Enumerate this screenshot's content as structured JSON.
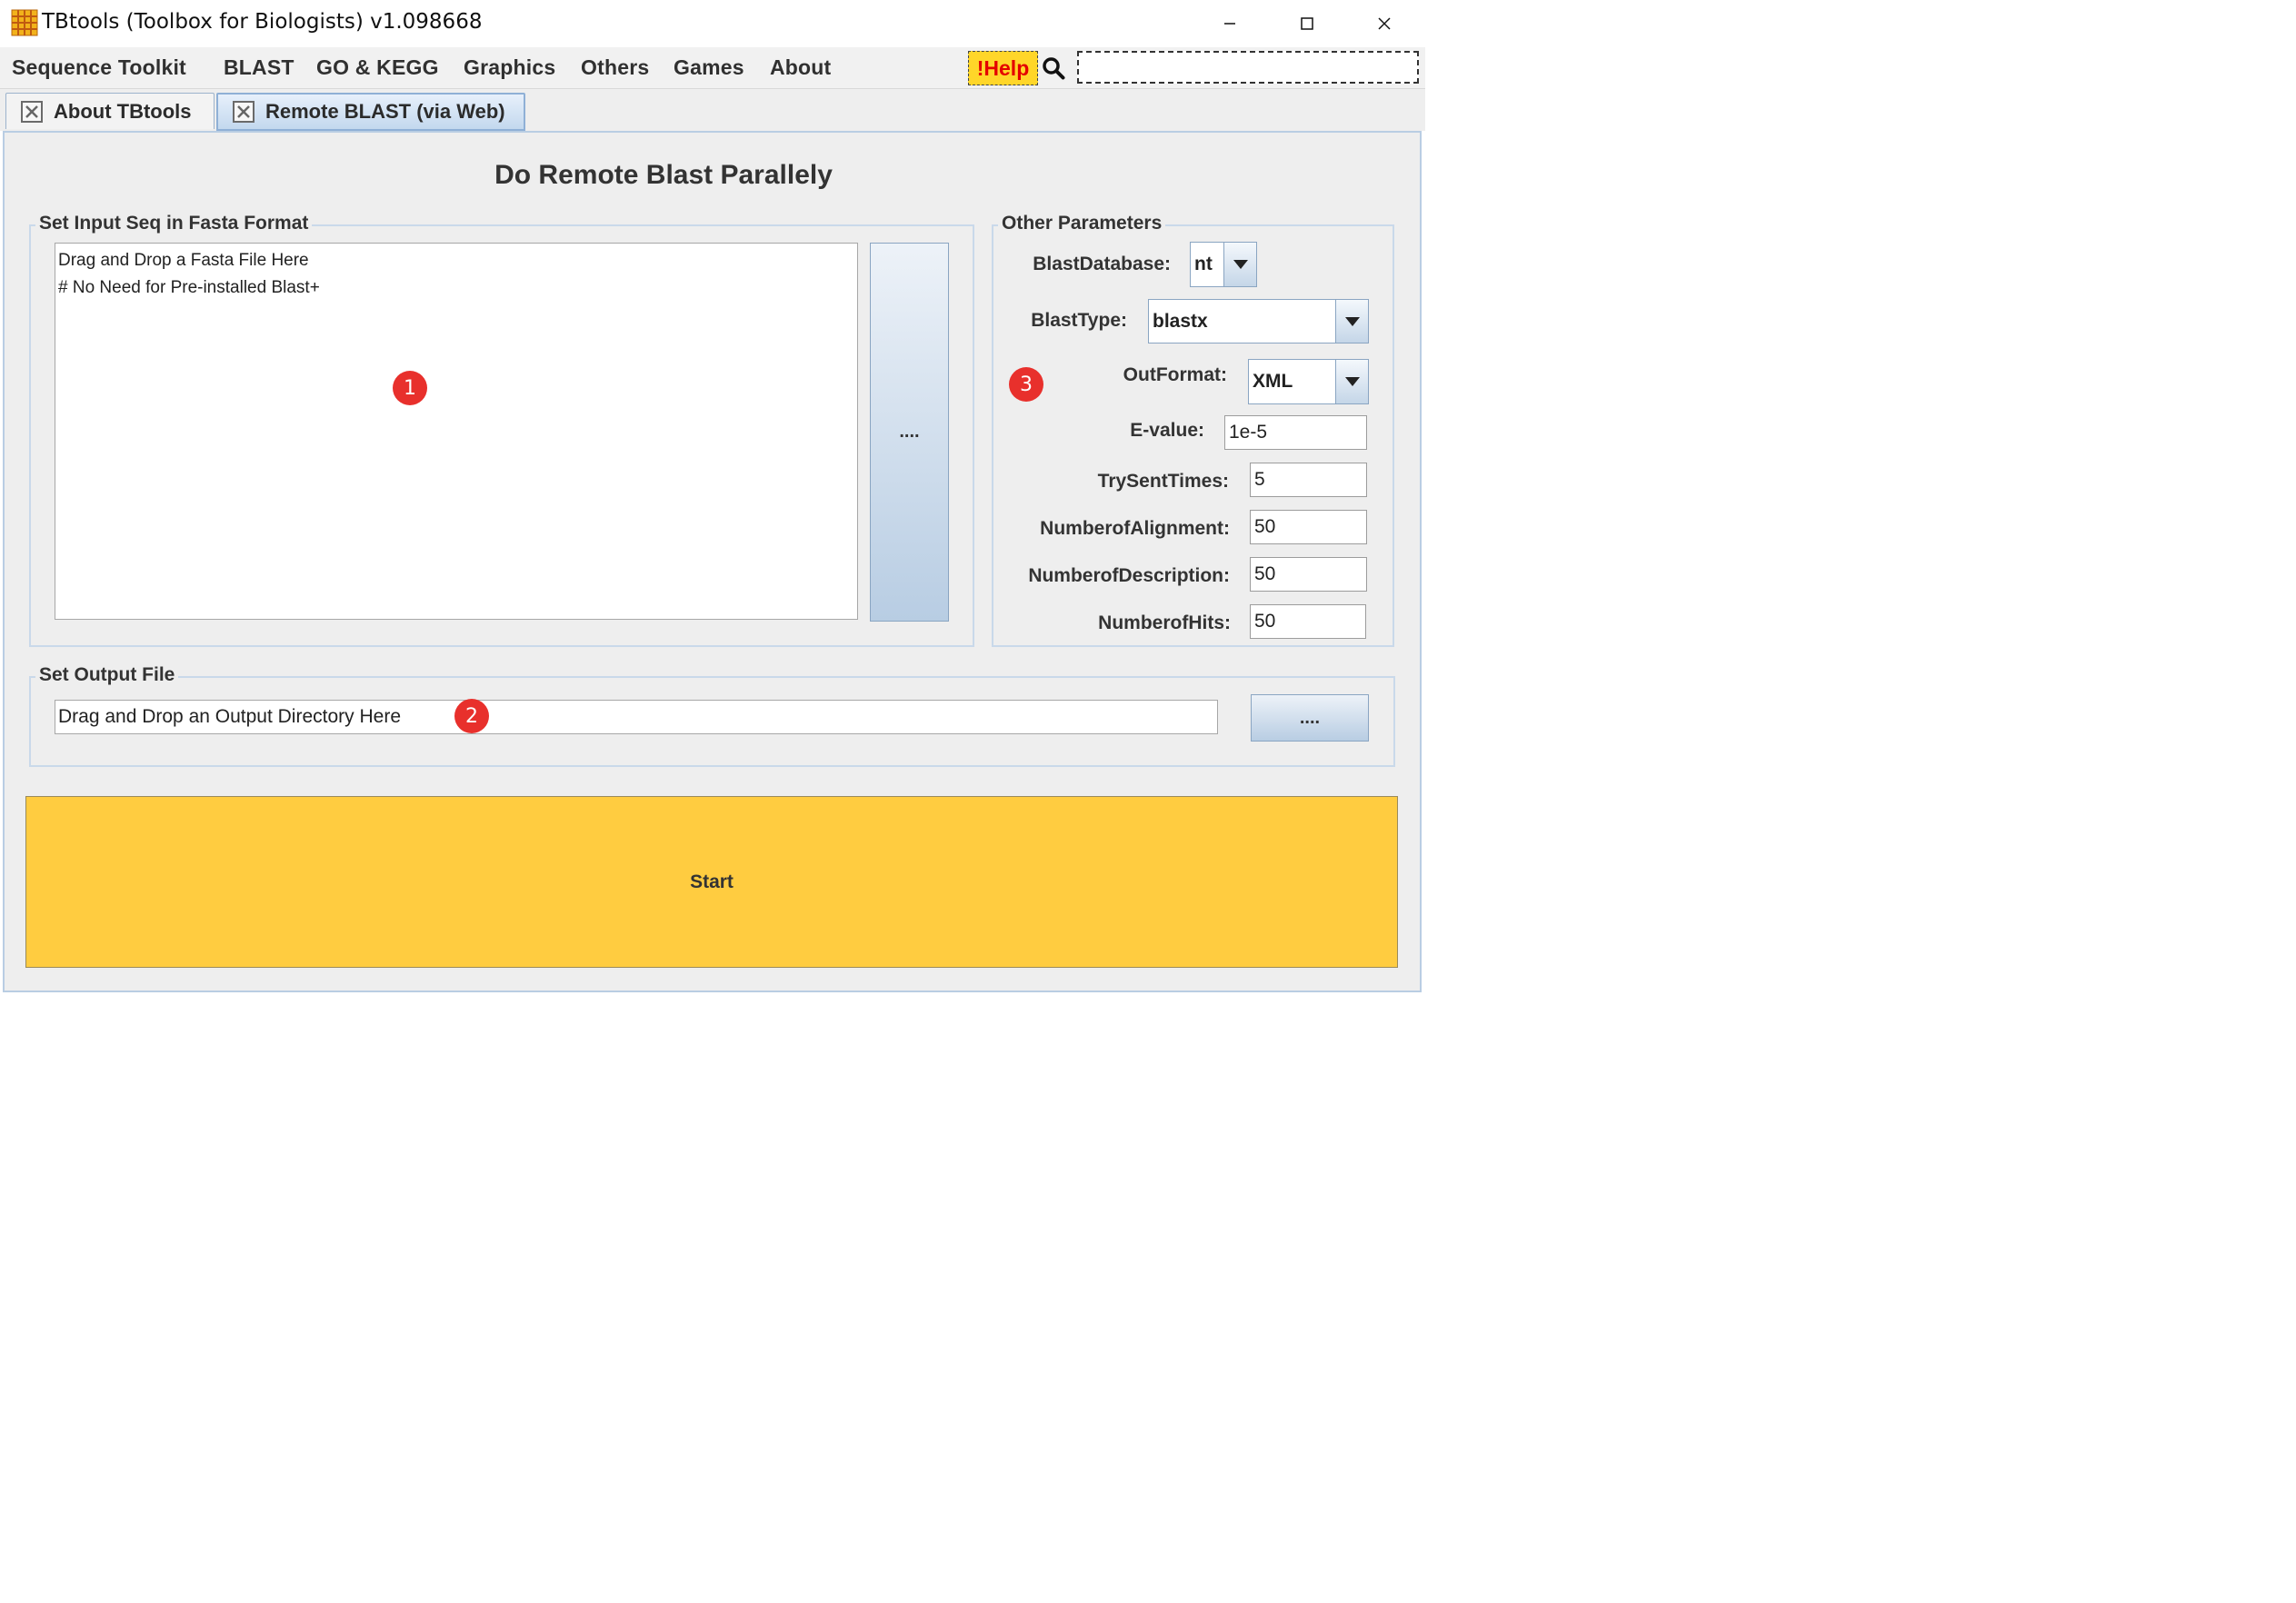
{
  "window": {
    "title": "TBtools (Toolbox for Biologists) v1.098668",
    "minimize_icon": "minimize-icon",
    "maximize_icon": "maximize-icon",
    "close_icon": "close-icon"
  },
  "menubar": {
    "items": [
      {
        "label": "Sequence Toolkit"
      },
      {
        "label": "BLAST"
      },
      {
        "label": "GO & KEGG"
      },
      {
        "label": "Graphics"
      },
      {
        "label": "Others"
      },
      {
        "label": "Games"
      },
      {
        "label": "About"
      }
    ],
    "help_label": "!Help",
    "search_icon": "search-icon",
    "search_value": ""
  },
  "tabs": [
    {
      "label": "About TBtools",
      "selected": false
    },
    {
      "label": "Remote BLAST (via Web)",
      "selected": true
    }
  ],
  "main": {
    "title": "Do Remote Blast Parallely",
    "input_group": {
      "title": "Set Input Seq in Fasta Format",
      "placeholder_lines": [
        "Drag and Drop a Fasta File Here",
        "# No Need for Pre-installed Blast+"
      ],
      "browse_label": "...."
    },
    "params_group": {
      "title": "Other Parameters",
      "blast_database": {
        "label": "BlastDatabase:",
        "value": "nt"
      },
      "blast_type": {
        "label": "BlastType:",
        "value": "blastx"
      },
      "out_format": {
        "label": "OutFormat:",
        "value": "XML"
      },
      "evalue": {
        "label": "E-value:",
        "value": "1e-5"
      },
      "try_sent_times": {
        "label": "TrySentTimes:",
        "value": "5"
      },
      "number_of_alignment": {
        "label": "NumberofAlignment:",
        "value": "50"
      },
      "number_of_description": {
        "label": "NumberofDescription:",
        "value": "50"
      },
      "number_of_hits": {
        "label": "NumberofHits:",
        "value": "50"
      }
    },
    "output_group": {
      "title": "Set Output File",
      "value": "Drag and Drop an Output Directory Here",
      "browse_label": "...."
    },
    "start_label": "Start"
  },
  "annotations": {
    "badge_1": "1",
    "badge_2": "2",
    "badge_3": "3",
    "color": "#e8302c"
  },
  "colors": {
    "start_button": "#ffcc40",
    "help_button": "#ffd629",
    "help_text": "#e40000",
    "tab_selected": "#c3d8ee"
  }
}
